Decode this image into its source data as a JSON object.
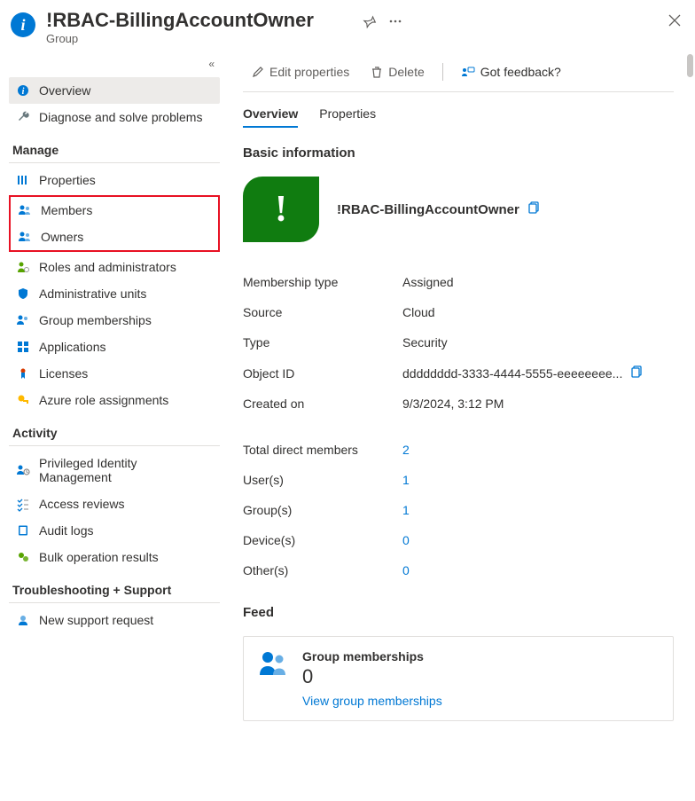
{
  "header": {
    "title": "!RBAC-BillingAccountOwner",
    "subtitle": "Group"
  },
  "sidebar": {
    "collapse_glyph": "«",
    "top": [
      {
        "label": "Overview",
        "icon": "info"
      },
      {
        "label": "Diagnose and solve problems",
        "icon": "wrench"
      }
    ],
    "sections": {
      "manage_label": "Manage",
      "manage": [
        {
          "label": "Properties",
          "icon": "props"
        },
        {
          "label": "Members",
          "icon": "people"
        },
        {
          "label": "Owners",
          "icon": "people"
        },
        {
          "label": "Roles and administrators",
          "icon": "admin"
        },
        {
          "label": "Administrative units",
          "icon": "shield"
        },
        {
          "label": "Group memberships",
          "icon": "people2"
        },
        {
          "label": "Applications",
          "icon": "apps"
        },
        {
          "label": "Licenses",
          "icon": "license"
        },
        {
          "label": "Azure role assignments",
          "icon": "key"
        }
      ],
      "activity_label": "Activity",
      "activity": [
        {
          "label": "Privileged Identity Management",
          "icon": "pim"
        },
        {
          "label": "Access reviews",
          "icon": "checklist"
        },
        {
          "label": "Audit logs",
          "icon": "book"
        },
        {
          "label": "Bulk operation results",
          "icon": "bulkop"
        }
      ],
      "ts_label": "Troubleshooting + Support",
      "ts": [
        {
          "label": "New support request",
          "icon": "support"
        }
      ]
    }
  },
  "commands": {
    "edit": "Edit properties",
    "delete": "Delete",
    "feedback": "Got feedback?"
  },
  "tabs": {
    "overview": "Overview",
    "properties": "Properties"
  },
  "basic": {
    "section": "Basic information",
    "group_name": "!RBAC-BillingAccountOwner",
    "avatar_glyph": "!",
    "rows": {
      "membership_type": {
        "k": "Membership type",
        "v": "Assigned"
      },
      "source": {
        "k": "Source",
        "v": "Cloud"
      },
      "type": {
        "k": "Type",
        "v": "Security"
      },
      "object_id": {
        "k": "Object ID",
        "v": "dddddddd-3333-4444-5555-eeeeeeee..."
      },
      "created_on": {
        "k": "Created on",
        "v": "9/3/2024, 3:12 PM"
      }
    }
  },
  "members": {
    "total": {
      "k": "Total direct members",
      "v": "2"
    },
    "users": {
      "k": "User(s)",
      "v": "1"
    },
    "groups": {
      "k": "Group(s)",
      "v": "1"
    },
    "devices": {
      "k": "Device(s)",
      "v": "0"
    },
    "others": {
      "k": "Other(s)",
      "v": "0"
    }
  },
  "feed": {
    "section": "Feed",
    "card_title": "Group memberships",
    "card_count": "0",
    "card_link": "View group memberships"
  }
}
